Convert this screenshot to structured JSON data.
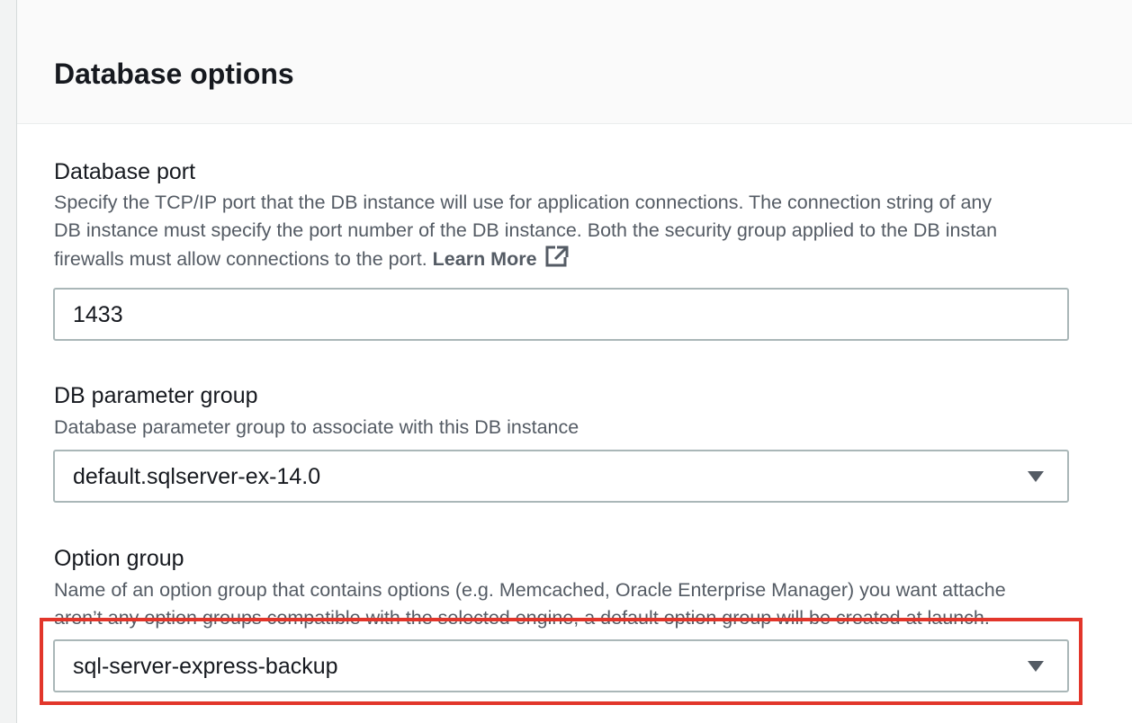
{
  "section": {
    "title": "Database options"
  },
  "database_port": {
    "label": "Database port",
    "description_lines": [
      "Specify the TCP/IP port that the DB instance will use for application connections. The connection string of any",
      "DB instance must specify the port number of the DB instance. Both the security group applied to the DB instan",
      "firewalls must allow connections to the port."
    ],
    "learn_more": "Learn More",
    "learn_more_icon": "external-link-icon",
    "value": "1433"
  },
  "db_parameter_group": {
    "label": "DB parameter group",
    "description": "Database parameter group to associate with this DB instance",
    "selected": "default.sqlserver-ex-14.0",
    "icon": "caret-down-icon"
  },
  "option_group": {
    "label": "Option group",
    "description_lines": [
      "Name of an option group that contains options (e.g. Memcached, Oracle Enterprise Manager) you want attache",
      "aren’t any option groups compatible with the selected engine, a default option group will be created at launch."
    ],
    "selected": "sql-server-express-backup",
    "icon": "caret-down-icon"
  },
  "annotation": {
    "highlight_color": "#e2362b"
  }
}
